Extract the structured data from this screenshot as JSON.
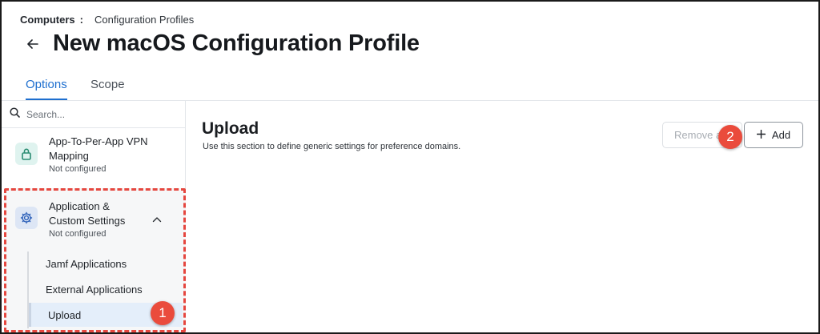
{
  "breadcrumb": {
    "root": "Computers",
    "separator": ":",
    "current": "Configuration Profiles"
  },
  "page": {
    "title": "New macOS Configuration Profile"
  },
  "tabs": [
    {
      "label": "Options",
      "active": true
    },
    {
      "label": "Scope",
      "active": false
    }
  ],
  "sidebar": {
    "search_placeholder": "Search...",
    "items": [
      {
        "label": "App-To-Per-App VPN Mapping",
        "status": "Not configured",
        "icon": "lock-icon"
      },
      {
        "label": "Application & Custom Settings",
        "status": "Not configured",
        "icon": "gear-icon",
        "expanded": true,
        "subitems": [
          {
            "label": "Jamf Applications"
          },
          {
            "label": "External Applications"
          },
          {
            "label": "Upload",
            "selected": true
          }
        ]
      }
    ]
  },
  "main": {
    "section_title": "Upload",
    "section_description": "Use this section to define generic settings for preference domains.",
    "remove_label": "Remove all",
    "add_label": "Add"
  },
  "annotations": [
    {
      "number": "1"
    },
    {
      "number": "2"
    }
  ],
  "colors": {
    "accent": "#1e6fcf",
    "annotation": "#ea4b3c",
    "highlight_border": "#e5473f"
  }
}
